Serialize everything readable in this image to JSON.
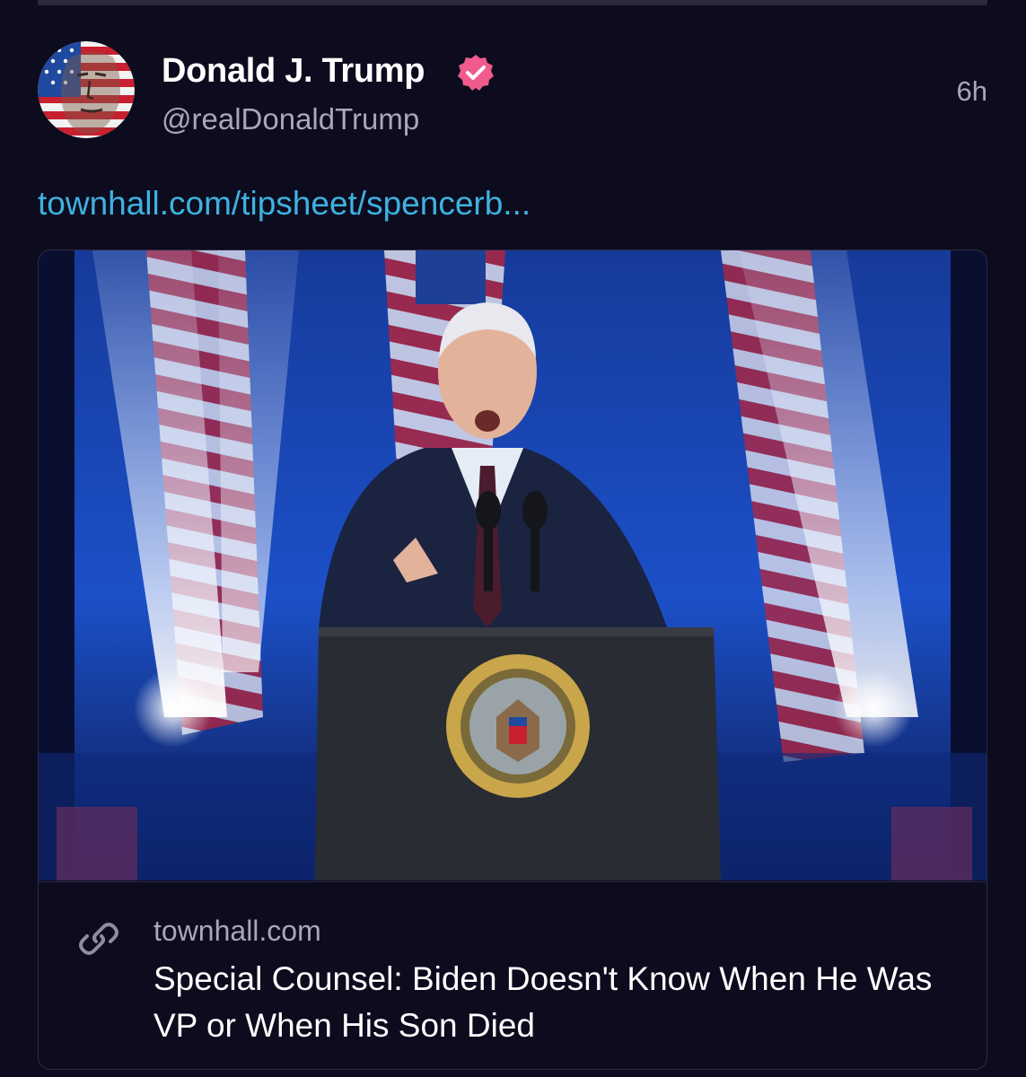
{
  "post": {
    "author": {
      "name": "Donald J. Trump",
      "handle": "@realDonaldTrump",
      "verified": true
    },
    "timestamp": "6h",
    "link_text": "townhall.com/tipsheet/spencerb...",
    "card": {
      "domain": "townhall.com",
      "title": "Special Counsel: Biden Doesn't Know When He Was VP or When His Son Died"
    }
  },
  "icons": {
    "verified": "verified-badge-icon",
    "link": "link-chain-icon"
  },
  "colors": {
    "background": "#0d0b1e",
    "link": "#3db2e0",
    "verified_badge": "#f05a8c",
    "secondary_text": "#a8a6b8",
    "border": "#2e2c42"
  }
}
